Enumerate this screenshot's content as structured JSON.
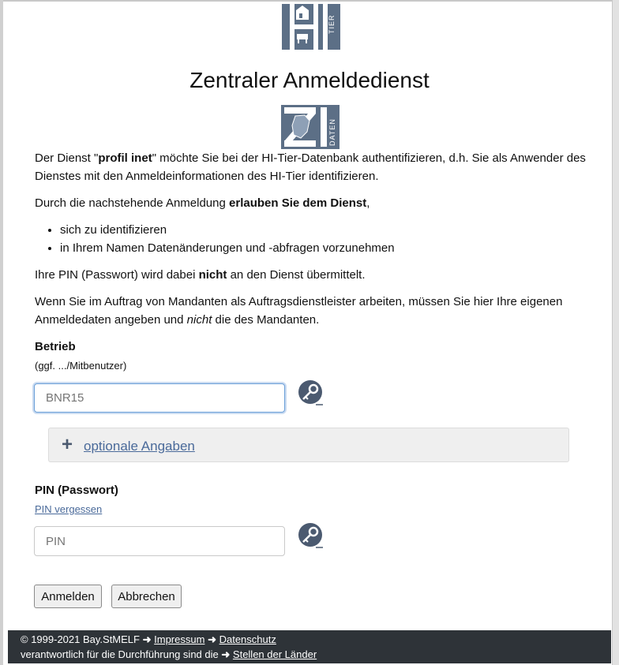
{
  "header": {
    "logo_name": "hi-tier-logo",
    "logo_text": "TIER",
    "title": "Zentraler Anmeldedienst",
    "zi_logo_text": "DATEN"
  },
  "intro": {
    "p1_before": "Der Dienst \"",
    "p1_service": "profil inet",
    "p1_after": "\" möchte Sie bei der HI-Tier-Datenbank authentifizieren, d.h. Sie als Anwender des Dienstes mit den Anmeldeinformationen des HI-Tier identifizieren.",
    "p2_before": "Durch die nachstehende Anmeldung ",
    "p2_bold": "erlauben Sie dem Dienst",
    "p2_after": ",",
    "bullets": [
      "sich zu identifizieren",
      "in Ihrem Namen Datenänderungen und -abfragen vorzunehmen"
    ],
    "p3_before": "Ihre PIN (Passwort) wird dabei ",
    "p3_bold": "nicht",
    "p3_after": " an den Dienst übermittelt.",
    "p4_before": "Wenn Sie im Auftrag von Mandanten als Auftragsdienstleister arbeiten, müssen Sie hier Ihre eigenen Anmeldedaten angeben und ",
    "p4_italic": "nicht",
    "p4_after": " die des Mandanten."
  },
  "form": {
    "betrieb_label": "Betrieb",
    "betrieb_hint": "(ggf. .../Mitbenutzer)",
    "betrieb_value": "",
    "betrieb_placeholder": "BNR15",
    "optional_label": " optionale Angaben",
    "pin_label": "PIN (Passwort)",
    "pin_forgot": "PIN vergessen",
    "pin_value": "",
    "pin_placeholder": "PIN",
    "login_button": "Anmelden",
    "cancel_button": "Abbrechen"
  },
  "footer": {
    "copyright": "© 1999-2021 Bay.StMELF",
    "impressum": "Impressum",
    "datenschutz": "Datenschutz",
    "responsible": "verantwortlich für die Durchführung sind die",
    "stellen": "Stellen der Länder"
  },
  "colors": {
    "logo_bg": "#5c6f86",
    "link": "#4a6a9a",
    "footer_bg": "#2e3338",
    "focus_border": "#6a9fd8"
  }
}
